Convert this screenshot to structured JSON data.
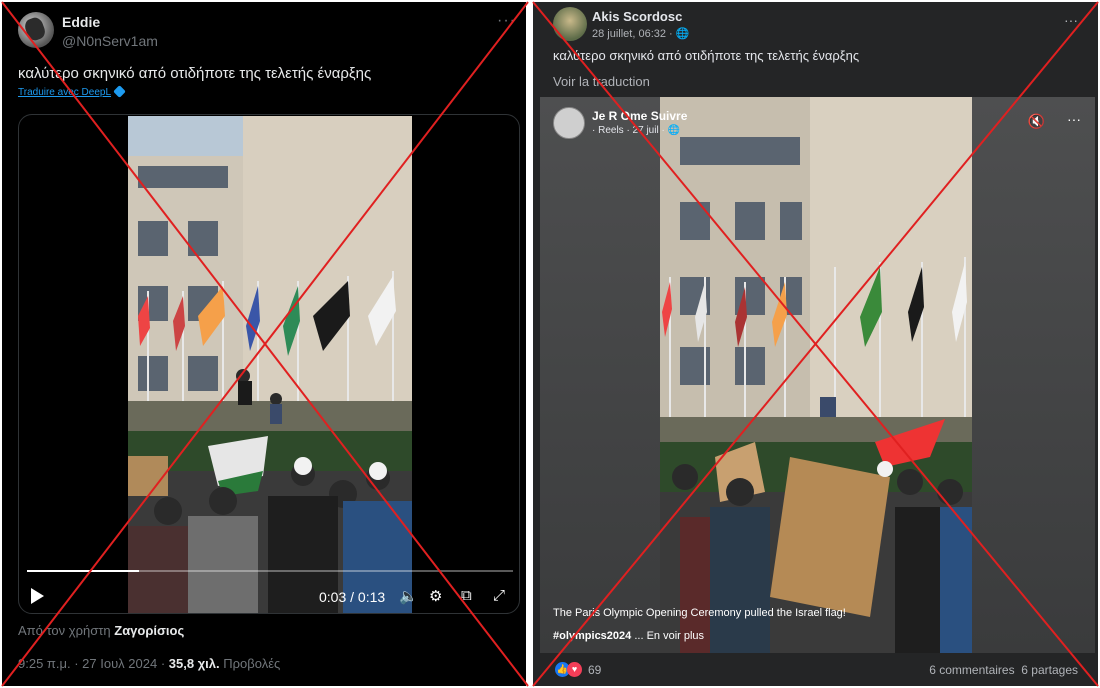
{
  "tweet": {
    "name": "Eddie",
    "handle": "@N0nServ1am",
    "more": "···",
    "text": "καλύτερο σκηνικό από οτιδήποτε της τελετής έναρξης",
    "translate_link": "Traduire avec DeepL",
    "video": {
      "time": "0:03 / 0:13",
      "progress_fraction": 0.23
    },
    "from_prefix": "Από τον χρήστη",
    "from_user": "Ζαγορίσιος",
    "time_date": "9:25 π.μ. · 27 Ιουλ 2024 ·",
    "views": "35,8 χιλ.",
    "views_label": "Προβολές"
  },
  "fb": {
    "name": "Akis Scordosc",
    "date": "28 juillet, 06:32 ·",
    "more": "···",
    "text": "καλύτερο σκηνικό από οτιδήποτε της τελετής έναρξης",
    "translate_link": "Voir la traduction",
    "reel": {
      "author": "Je R Ome Suivre",
      "sub": "· Reels · 27 juil ·",
      "more": "···",
      "caption": "The Paris Olympic Opening Ceremony pulled the Israel flag!",
      "hashtag": "#olympics2024",
      "see_more": "... En voir plus"
    },
    "reaction_count": "69",
    "comments": "6 commentaires",
    "shares": "6 partages"
  },
  "colors": {
    "x_mark": "#e02020",
    "tw_link": "#1d9bf0",
    "fb_like": "#1877f2",
    "fb_love": "#f33e58"
  }
}
